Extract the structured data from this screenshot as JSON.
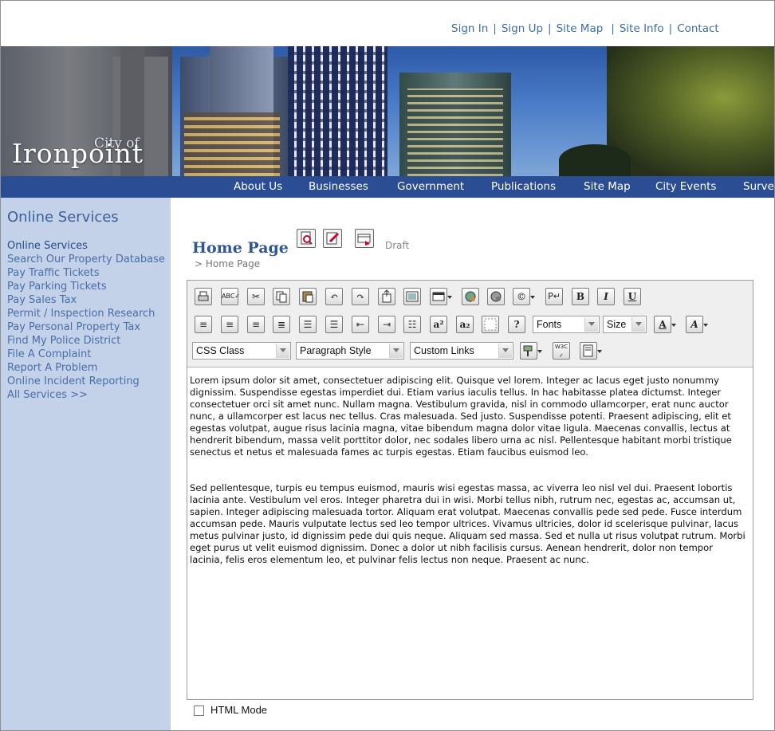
{
  "top_links": [
    "Sign In",
    "Sign Up",
    "Site Map",
    "Site Info",
    "Contact"
  ],
  "logo": {
    "small": "City of",
    "large": "Ironpoint"
  },
  "nav": [
    "About Us",
    "Businesses",
    "Government",
    "Publications",
    "Site Map",
    "City Events",
    "Survey"
  ],
  "sidebar": {
    "title": "Online Services",
    "items": [
      "Online Services",
      "Search Our Property Database",
      "Pay Traffic Tickets",
      "Pay Parking Tickets",
      "Pay Sales Tax",
      "Permit / Inspection Research",
      "Pay Personal Property Tax",
      "Find My Police District",
      "File A Complaint",
      "Report A Problem",
      "Online Incident Reporting",
      "All Services >>"
    ]
  },
  "page": {
    "title": "Home Page",
    "breadcrumb": "> Home Page",
    "status": "Draft"
  },
  "toolbar": {
    "fonts_label": "Fonts",
    "size_label": "Size",
    "css_class_label": "CSS Class",
    "paragraph_style_label": "Paragraph Style",
    "custom_links_label": "Custom Links",
    "row1_icons": [
      "print-icon",
      "spellcheck-icon",
      "cut-icon",
      "copy-icon",
      "paste-icon",
      "undo-icon",
      "redo-icon",
      "insert-file-icon",
      "image-icon",
      "table-icon",
      "hyperlink-icon",
      "remove-link-icon",
      "special-char-icon",
      "paragraph-mark-icon",
      "bold-icon",
      "italic-icon",
      "underline-icon"
    ],
    "row2_icons": [
      "align-left-icon",
      "align-center-icon",
      "align-right-icon",
      "justify-icon",
      "numbered-list-icon",
      "bullet-list-icon",
      "outdent-icon",
      "indent-icon",
      "list-style-icon",
      "superscript-icon",
      "subscript-icon",
      "guidelines-icon",
      "help-icon",
      "font-color-icon",
      "highlight-color-icon"
    ],
    "row3_icons": [
      "format-painter-icon",
      "w3c-validate-icon",
      "source-view-icon"
    ]
  },
  "editor_content": [
    "Lorem ipsum dolor sit amet, consectetuer adipiscing elit. Quisque vel lorem. Integer ac lacus eget justo nonummy dignissim. Suspendisse egestas imperdiet dui. Etiam varius iaculis tellus. In hac habitasse platea dictumst. Integer consectetuer orci sit amet nunc. Nullam magna. Vestibulum gravida, nisl in commodo ullamcorper, erat nunc auctor nunc, a ullamcorper est lacus nec tellus. Cras malesuada. Sed justo. Suspendisse potenti. Praesent adipiscing, elit et egestas volutpat, augue risus lacinia magna, vitae bibendum magna dolor vitae ligula. Maecenas convallis, lectus at hendrerit bibendum, massa velit porttitor dolor, nec sodales libero urna ac nisl. Pellentesque habitant morbi tristique senectus et netus et malesuada fames ac turpis egestas. Etiam faucibus euismod leo.",
    "Sed pellentesque, turpis eu tempus euismod, mauris wisi egestas massa, ac viverra leo nisl vel dui. Praesent lobortis lacinia ante. Vestibulum vel eros. Integer pharetra dui in wisi. Morbi tellus nibh, rutrum nec, egestas ac, accumsan ut, sapien. Integer adipiscing malesuada tortor. Aliquam erat volutpat. Maecenas convallis pede sed pede. Fusce interdum accumsan pede. Mauris vulputate lectus sed leo tempor ultrices. Vivamus ultricies, dolor id scelerisque pulvinar, lacus metus pulvinar justo, id dignissim pede dui quis neque. Aliquam sed massa. Sed et nulla ut risus volutpat rutrum. Morbi eget purus ut velit euismod dignissim. Donec a dolor ut nibh facilisis cursus. Aenean hendrerit, dolor non tempor lacinia, felis eros elementum leo, et pulvinar felis lectus non neque. Praesent ac nunc."
  ],
  "html_mode_label": "HTML Mode",
  "colors": {
    "nav_bar": "#2a4d93",
    "sidebar_bg": "#c3d1e9",
    "link": "#3d6ea4",
    "title": "#2f5791"
  }
}
